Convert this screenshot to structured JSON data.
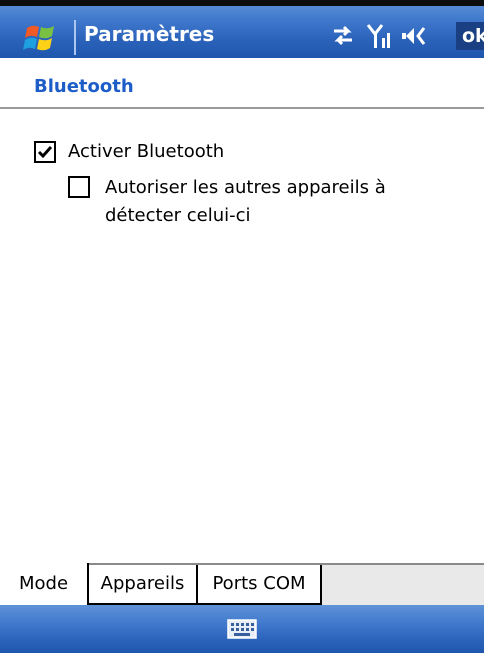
{
  "titlebar": {
    "title": "Paramètres",
    "ok_label": "ok",
    "icons": [
      "windows-start-icon",
      "connectivity-icon",
      "signal-icon",
      "volume-icon"
    ]
  },
  "header": {
    "title": "Bluetooth"
  },
  "options": {
    "activer": {
      "label": "Activer Bluetooth",
      "checked": true
    },
    "autoriser": {
      "line1": "Autoriser les autres appareils à",
      "line2": "détecter celui-ci",
      "checked": false
    }
  },
  "tabs": [
    {
      "label": "Mode",
      "active": true
    },
    {
      "label": "Appareils",
      "active": false
    },
    {
      "label": "Ports COM",
      "active": false
    }
  ],
  "cmdbar": {
    "icon": "keyboard-icon"
  },
  "colors": {
    "bar_blue": "#2a62ba",
    "heading_blue": "#1c5dc8",
    "ok_bg": "#1a3f82"
  }
}
